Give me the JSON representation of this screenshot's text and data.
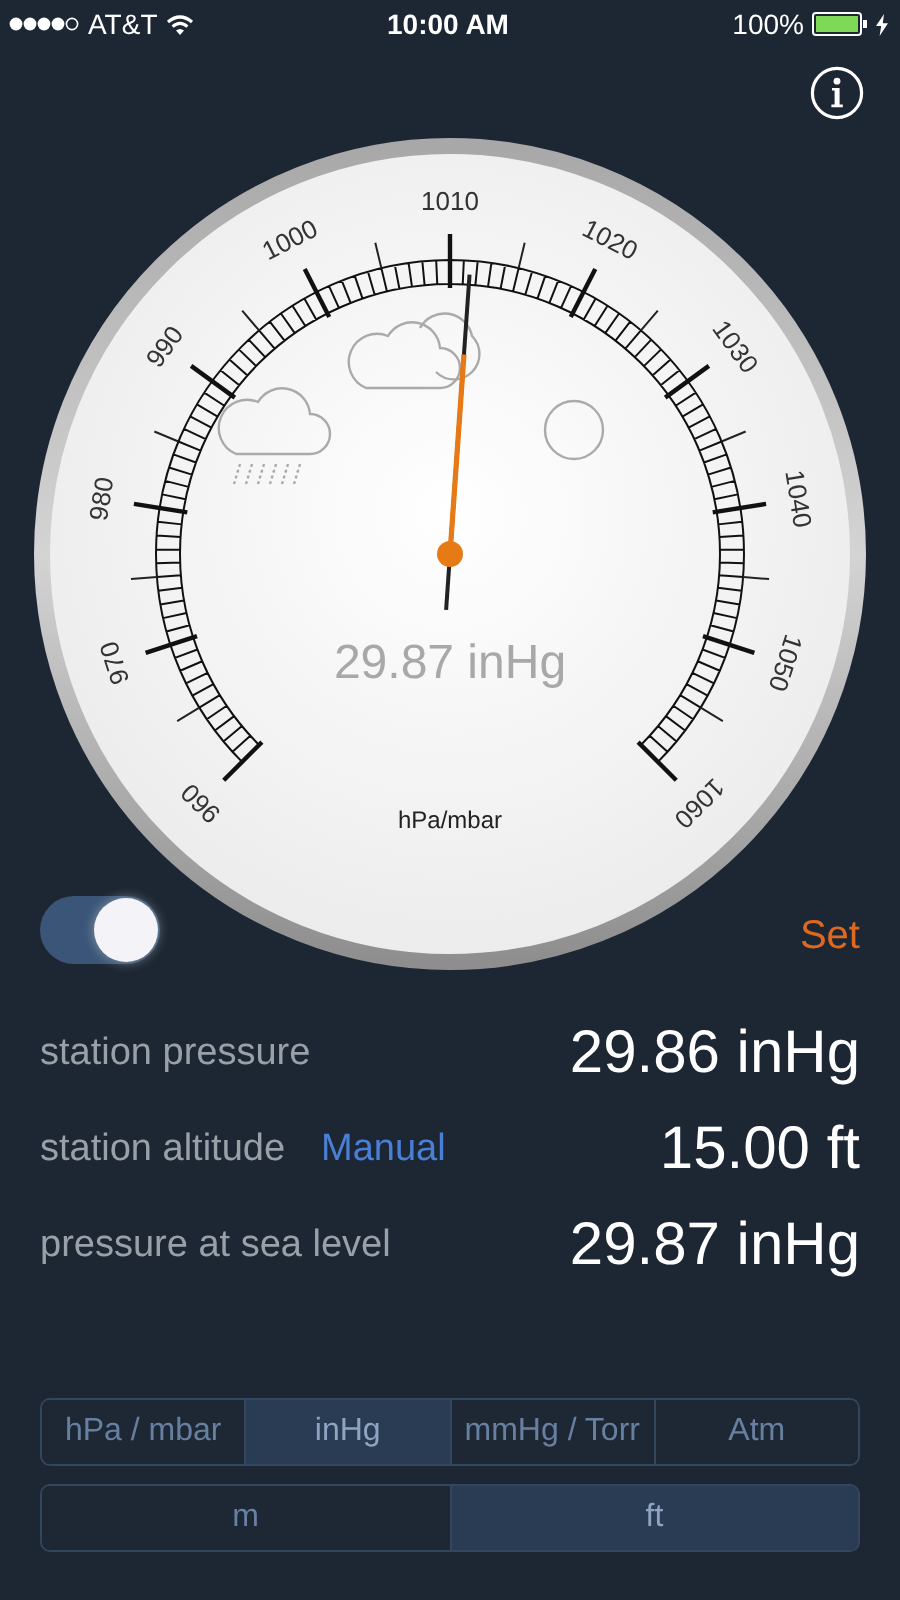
{
  "status_bar": {
    "carrier": "AT&T",
    "time": "10:00 AM",
    "battery": "100%"
  },
  "gauge": {
    "scale_labels": [
      "960",
      "970",
      "980",
      "990",
      "1000",
      "1010",
      "1020",
      "1030",
      "1040",
      "1050",
      "1060"
    ],
    "reading": "29.87 inHg",
    "unit": "hPa/mbar"
  },
  "toggle": {
    "on": true
  },
  "set_button": "Set",
  "readings": [
    {
      "label": "station pressure",
      "value": "29.86 inHg"
    },
    {
      "label": "station altitude",
      "link": "Manual",
      "value": "15.00 ft"
    },
    {
      "label": "pressure at sea level",
      "value": "29.87 inHg"
    }
  ],
  "pressure_units": [
    {
      "label": "hPa / mbar",
      "selected": false
    },
    {
      "label": "inHg",
      "selected": true
    },
    {
      "label": "mmHg / Torr",
      "selected": false
    },
    {
      "label": "Atm",
      "selected": false
    }
  ],
  "altitude_units": [
    {
      "label": "m",
      "selected": false
    },
    {
      "label": "ft",
      "selected": true
    }
  ]
}
